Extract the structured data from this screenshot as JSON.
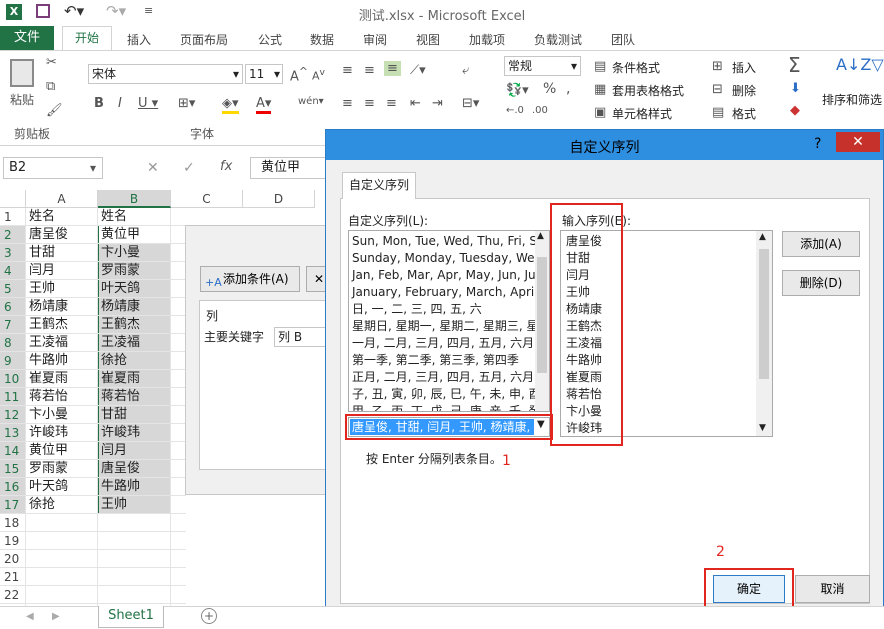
{
  "window": {
    "title": "测试.xlsx - Microsoft Excel"
  },
  "ribbon": {
    "file": "文件",
    "tabs": [
      "开始",
      "插入",
      "页面布局",
      "公式",
      "数据",
      "审阅",
      "视图",
      "加载项",
      "负载测试",
      "团队"
    ],
    "groups": {
      "clipboard": "剪贴板",
      "font": "字体"
    },
    "paste": "粘贴",
    "font_name": "宋体",
    "font_size": "11",
    "number_format": "常规",
    "cond_format": "条件格式",
    "table_format": "套用表格格式",
    "cell_style": "单元格样式",
    "insert": "插入",
    "delete": "删除",
    "format": "格式",
    "sort_filter": "排序和筛选"
  },
  "formula_bar": {
    "name_box": "B2",
    "fx": "fx",
    "value": "黄位甲"
  },
  "grid": {
    "columns": [
      "A",
      "B",
      "C",
      "D"
    ],
    "rows": [
      {
        "n": "1",
        "a": "姓名",
        "b": "姓名"
      },
      {
        "n": "2",
        "a": "唐呈俊",
        "b": "黄位甲"
      },
      {
        "n": "3",
        "a": "甘甜",
        "b": "卞小曼"
      },
      {
        "n": "4",
        "a": "闫月",
        "b": "罗雨蒙"
      },
      {
        "n": "5",
        "a": "王帅",
        "b": "叶天鸽"
      },
      {
        "n": "6",
        "a": "杨靖康",
        "b": "杨靖康"
      },
      {
        "n": "7",
        "a": "王鹤杰",
        "b": "王鹤杰"
      },
      {
        "n": "8",
        "a": "王凌福",
        "b": "王凌福"
      },
      {
        "n": "9",
        "a": "牛路帅",
        "b": "徐抢"
      },
      {
        "n": "10",
        "a": "崔夏雨",
        "b": "崔夏雨"
      },
      {
        "n": "11",
        "a": "蒋若怡",
        "b": "蒋若怡"
      },
      {
        "n": "12",
        "a": "卞小曼",
        "b": "甘甜"
      },
      {
        "n": "13",
        "a": "许峻玮",
        "b": "许峻玮"
      },
      {
        "n": "14",
        "a": "黄位甲",
        "b": "闫月"
      },
      {
        "n": "15",
        "a": "罗雨蒙",
        "b": "唐呈俊"
      },
      {
        "n": "16",
        "a": "叶天鸽",
        "b": "牛路帅"
      },
      {
        "n": "17",
        "a": "徐抢",
        "b": "王帅"
      },
      {
        "n": "18",
        "a": "",
        "b": ""
      },
      {
        "n": "19",
        "a": "",
        "b": ""
      },
      {
        "n": "20",
        "a": "",
        "b": ""
      },
      {
        "n": "21",
        "a": "",
        "b": ""
      },
      {
        "n": "22",
        "a": "",
        "b": ""
      }
    ]
  },
  "sort_dialog": {
    "add_condition": "添加条件(A)",
    "column": "列",
    "primary_key": "主要关键字",
    "key_value": "列 B"
  },
  "dialog": {
    "title": "自定义序列",
    "help": "?",
    "tab": "自定义序列",
    "list_label": "自定义序列(L):",
    "entries_label": "输入序列(E):",
    "lists": [
      "Sun, Mon, Tue, Wed, Thu, Fri, S",
      "Sunday, Monday, Tuesday, Wed",
      "Jan, Feb, Mar, Apr, May, Jun, Ju",
      "January, February, March, April",
      "日, 一, 二, 三, 四, 五, 六",
      "星期日, 星期一, 星期二, 星期三, 星",
      "一月, 二月, 三月, 四月, 五月, 六月,",
      "第一季, 第二季, 第三季, 第四季",
      "正月, 二月, 三月, 四月, 五月, 六月,",
      "子, 丑, 寅, 卯, 辰, 巳, 午, 未, 申, 酉",
      "甲, 乙, 丙, 丁, 戊, 己, 庚, 辛, 壬, 癸"
    ],
    "selected_list": "唐呈俊, 甘甜, 闫月, 王帅, 杨靖康,",
    "entries": [
      "唐呈俊",
      "甘甜",
      "闫月",
      "王帅",
      "杨靖康",
      "王鹤杰",
      "王凌福",
      "牛路帅",
      "崔夏雨",
      "蒋若怡",
      "卞小曼",
      "许峻玮"
    ],
    "add": "添加(A)",
    "delete": "删除(D)",
    "hint": "按 Enter 分隔列表条目。",
    "ok": "确定",
    "cancel": "取消",
    "marker1": "1",
    "marker2": "2"
  },
  "sheet": {
    "tab": "Sheet1"
  },
  "colors": {
    "accent": "#217346",
    "dialog_title": "#2e8ee0",
    "close": "#c7312b",
    "highlight": "#e0261f",
    "selection": "#3399ff"
  }
}
